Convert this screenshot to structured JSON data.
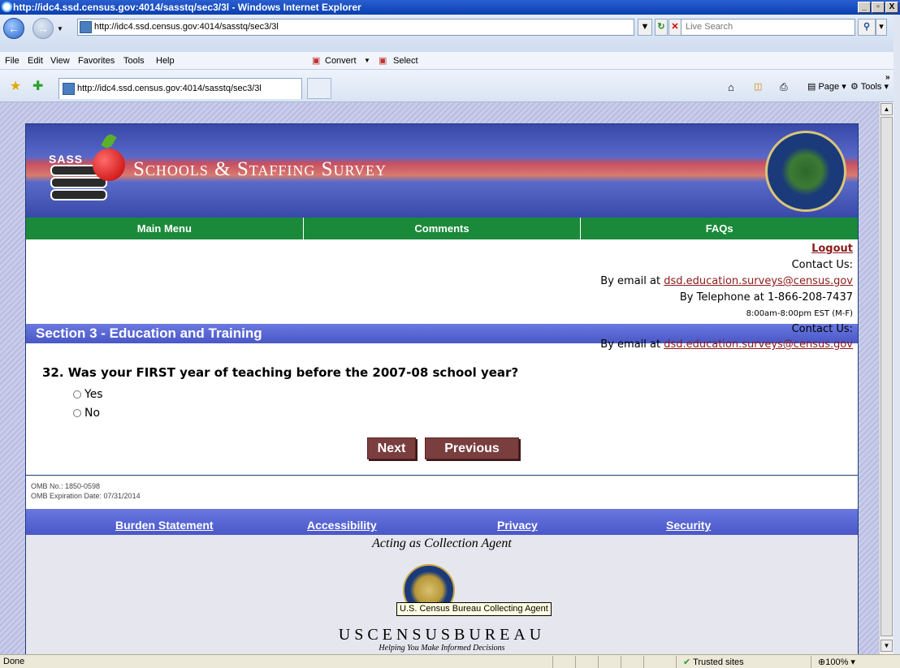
{
  "window": {
    "title": "http://idc4.ssd.census.gov:4014/sasstq/sec3/3l - Windows Internet Explorer",
    "minimize": "_",
    "restore": "▫",
    "close": "X"
  },
  "browser": {
    "address": "http://idc4.ssd.census.gov:4014/sasstq/sec3/3l",
    "search_placeholder": "Live Search",
    "menu": [
      "File",
      "Edit",
      "View",
      "Favorites",
      "Tools",
      "Help"
    ],
    "convert_label": "Convert",
    "select_label": "Select",
    "tab_title": "http://idc4.ssd.census.gov:4014/sasstq/sec3/3l",
    "page_label": "Page",
    "tools_label": "Tools"
  },
  "survey": {
    "sass_label": "SASS",
    "title": "Schools & Staffing Survey",
    "nav": [
      "Main Menu",
      "Comments",
      "FAQs"
    ],
    "logout": "Logout",
    "contact_us": "Contact Us:",
    "email_prefix": "By email at ",
    "email": "dsd.education.surveys@census.gov",
    "telephone": "By Telephone at 1-866-208-7437",
    "hours": "8:00am-8:00pm EST (M-F)",
    "section_title": "Section 3 - Education and Training",
    "question": "32. Was your FIRST year of teaching before the 2007-08 school year?",
    "options": [
      "Yes",
      "No"
    ],
    "next_label": "Next",
    "previous_label": "Previous",
    "omb_number": "OMB No.: 1850-0598",
    "omb_expiration": "OMB Expiration Date: 07/31/2014",
    "footer_links": [
      "Burden Statement",
      "Accessibility",
      "Privacy",
      "Security"
    ],
    "agent_text": "Acting as Collection Agent",
    "tooltip": "U.S. Census Bureau Collecting Agent",
    "census_name": "USCENSUSBUREAU",
    "tagline": "Helping You Make Informed Decisions"
  },
  "status": {
    "text": "Done",
    "zone": "Trusted sites",
    "zoom": "100%"
  },
  "colors": {
    "nav_green": "#1a8a3a",
    "section_blue": "#5060d0",
    "button_maroon": "#7a3e3e",
    "link_red": "#8b1a1a"
  }
}
